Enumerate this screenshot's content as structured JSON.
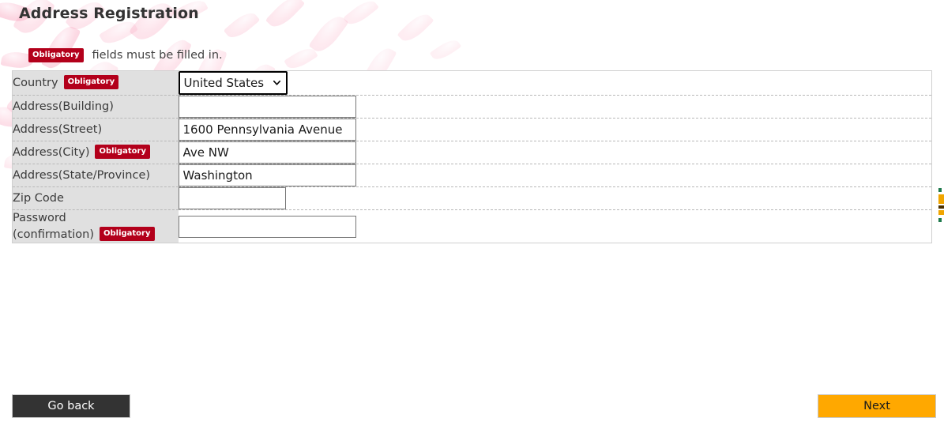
{
  "page": {
    "title": "Address Registration",
    "notice": {
      "badge": "Obligatory",
      "text": "fields must be filled in."
    }
  },
  "colors": {
    "badge_red": "#b3001b",
    "label_cell_bg": "#e0e0e0",
    "next_button_orange": "#ffa800",
    "back_button_dark": "#333333",
    "table_border": "#cfcfcf",
    "row_divider": "#b8b8b8",
    "petal_pink": "#f9a8c0"
  },
  "form": {
    "rows": [
      {
        "label": "Country",
        "required": true,
        "badge": "Obligatory",
        "control": "select",
        "value": "United States",
        "options": [
          "United States"
        ],
        "name": "country"
      },
      {
        "label": "Address(Building)",
        "required": false,
        "badge": "",
        "control": "text",
        "value": "",
        "placeholder": "",
        "size": "wide",
        "name": "address-building"
      },
      {
        "label": "Address(Street)",
        "required": false,
        "badge": "",
        "control": "text",
        "value": "1600 Pennsylvania Avenue",
        "placeholder": "",
        "size": "wide",
        "name": "address-street"
      },
      {
        "label": "Address(City)",
        "required": true,
        "badge": "Obligatory",
        "control": "text",
        "value": "Ave NW",
        "placeholder": "",
        "size": "wide",
        "name": "address-city"
      },
      {
        "label": "Address(State/Province)",
        "required": false,
        "badge": "",
        "control": "text",
        "value": "Washington",
        "placeholder": "",
        "size": "wide",
        "name": "address-state-province"
      },
      {
        "label": "Zip Code",
        "required": false,
        "badge": "",
        "control": "text",
        "value": "",
        "placeholder": "",
        "size": "narrow",
        "name": "zip-code"
      },
      {
        "label": "Password (confirmation)",
        "label_line1": "Password",
        "label_line2": "(confirmation)",
        "required": true,
        "badge": "Obligatory",
        "control": "text",
        "value": "",
        "placeholder": "",
        "size": "wide",
        "name": "password-confirmation"
      }
    ]
  },
  "footer": {
    "back_label": "Go back",
    "next_label": "Next"
  },
  "icons": {
    "chevron_down": "chevron-down-icon"
  }
}
